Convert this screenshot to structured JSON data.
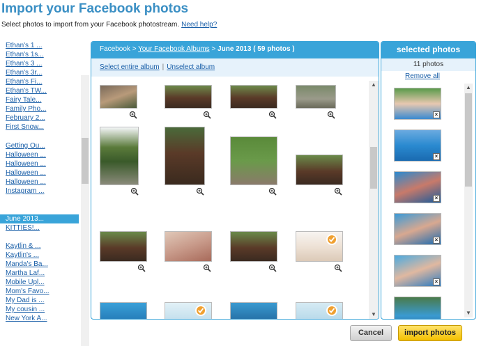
{
  "page": {
    "title": "Import your Facebook photos",
    "subtitle": "Select photos to import from your Facebook photostream.",
    "help_link": "Need help?"
  },
  "sidebar": {
    "albums": [
      "Ethan's 1 ...",
      "Ethan's 1s...",
      "Ethan's 3 ...",
      "Ethan's 3r...",
      "Ethan's Fi...",
      "Ethan's TW...",
      "Fairy Tale...",
      "Family Pho...",
      "February 2...",
      "First Snow...",
      "Getting Ou...",
      "Halloween ...",
      "Halloween ...",
      "Halloween ...",
      "Halloween ...",
      "Instagram ...",
      "June 2013...",
      "KITTIES!...",
      "Kaytlin & ...",
      "Kaytlin's ...",
      "Manda's Ba...",
      "Martha Laf...",
      "Mobile Upl...",
      "Mom's Favo...",
      "My Dad is ...",
      "My cousin ...",
      "New York A..."
    ],
    "selected": "June 2013..."
  },
  "main": {
    "breadcrumb": {
      "root": "Facebook",
      "sep1": ">",
      "albums_link": "Your Facebook Albums",
      "sep2": ">",
      "current": "June 2013 ( 59 photos )"
    },
    "select_all": "Select entire album",
    "divider": "|",
    "unselect": "Unselect album"
  },
  "selected_panel": {
    "title": "selected photos",
    "count": "11 photos",
    "remove_all": "Remove all",
    "remove_mark": "×"
  },
  "buttons": {
    "cancel": "Cancel",
    "import": "import photos"
  },
  "colors": {
    "accent": "#39a4d9",
    "title": "#3a8fc4",
    "link": "#1a5fa8",
    "check": "#f0a030",
    "import_button": "#f3c000"
  },
  "icons": {
    "zoom": "magnifier-plus-icon",
    "check": "checkmark-icon",
    "remove": "x-icon"
  }
}
